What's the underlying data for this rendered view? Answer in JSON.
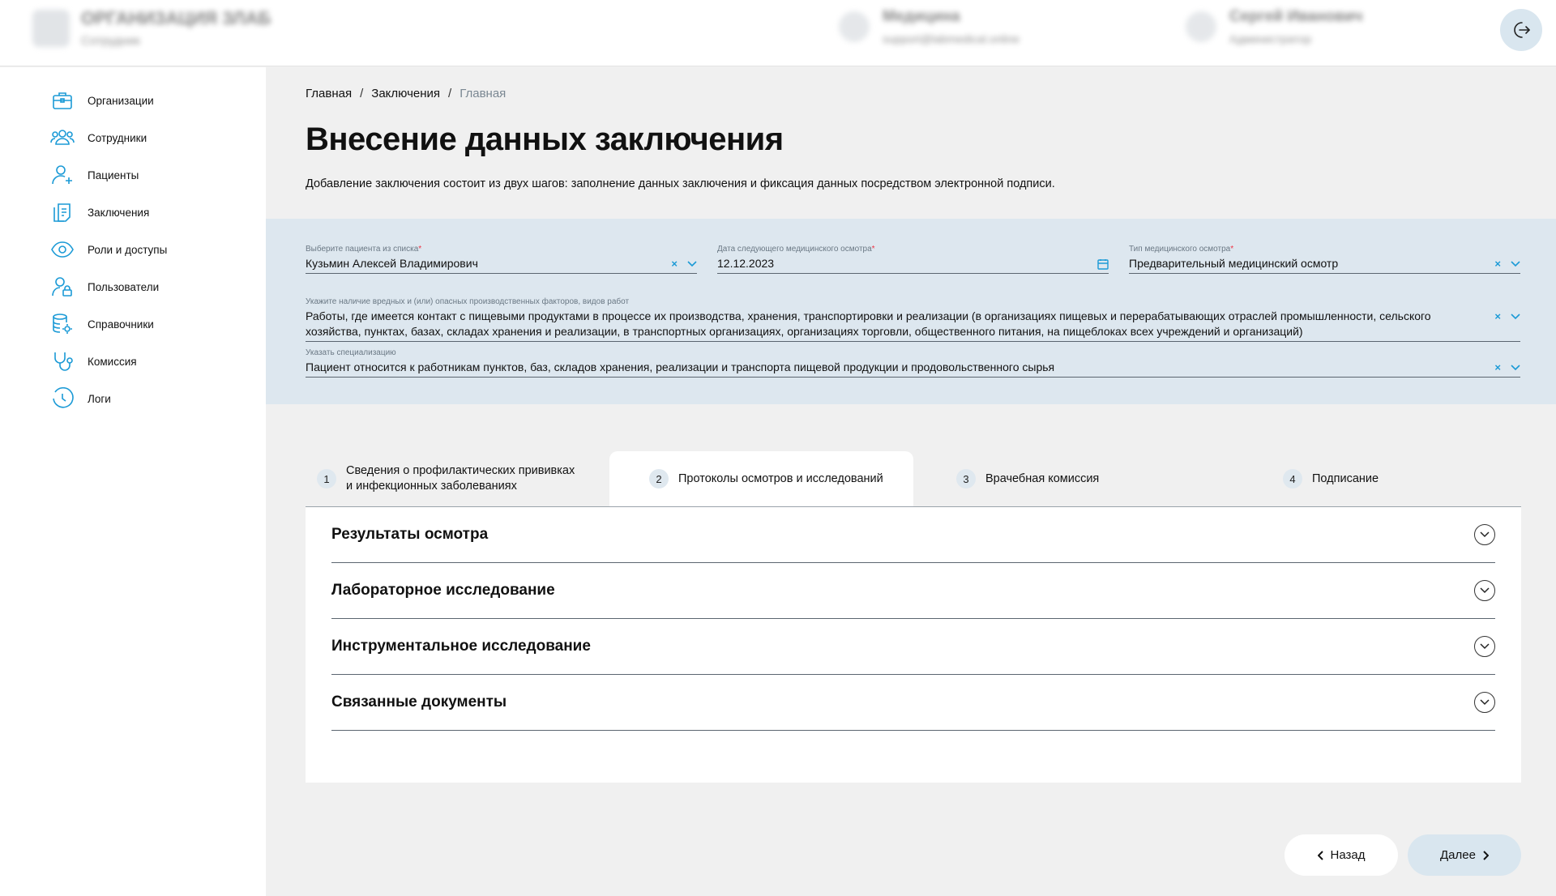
{
  "header": {
    "org_name": "ОРГАНИЗАЦИЯ ЗЛАБ",
    "org_sub": "Сотрудник",
    "block1_title": "Медицина",
    "block1_sub": "support@labmedical.online",
    "block2_title": "Сергей Иванович",
    "block2_sub": "Администратор"
  },
  "sidebar": {
    "items": [
      {
        "label": "Организации",
        "icon": "briefcase-icon"
      },
      {
        "label": "Сотрудники",
        "icon": "users-icon"
      },
      {
        "label": "Пациенты",
        "icon": "user-plus-icon"
      },
      {
        "label": "Заключения",
        "icon": "documents-icon"
      },
      {
        "label": "Роли и доступы",
        "icon": "eye-icon"
      },
      {
        "label": "Пользователи",
        "icon": "user-lock-icon"
      },
      {
        "label": "Справочники",
        "icon": "database-gear-icon"
      },
      {
        "label": "Комиссия",
        "icon": "stethoscope-icon"
      },
      {
        "label": "Логи",
        "icon": "clock-icon"
      }
    ]
  },
  "breadcrumb": [
    "Главная",
    "Заключения",
    "Главная"
  ],
  "page": {
    "title": "Внесение данных заключения",
    "description": "Добавление заключения состоит из двух шагов: заполнение данных заключения и фиксация данных посредством электронной подписи."
  },
  "form": {
    "patient": {
      "label": "Выберите пациента из списка",
      "value": "Кузьмин Алексей Владимирович"
    },
    "next_exam_date": {
      "label": "Дата следующего медицинского осмотра",
      "value": "12.12.2023"
    },
    "exam_type": {
      "label": "Тип медицинского осмотра",
      "value": "Предварительный медицинский осмотр"
    },
    "factors": {
      "label": "Укажите наличие вредных и (или) опасных производственных факторов, видов работ",
      "value": "Работы, где имеется контакт с пищевыми продуктами в процессе их производства, хранения, транспортировки и реализации (в организациях пищевых и перерабатывающих отраслей промышленности, сельского хозяйства, пунктах, базах, складах хранения и реализации, в транспортных организациях, организациях торговли, общественного питания, на пищеблоках всех учреждений и организаций)"
    },
    "specialization": {
      "label": "Указать специализацию",
      "value": "Пациент относится к работникам пунктов, баз, складов хранения, реализации и транспорта пищевой продукции и продовольственного сырья"
    },
    "required_mark": "*"
  },
  "tabs": [
    {
      "num": "1",
      "label_line1": "Сведения о профилактических прививках",
      "label_line2": "и инфекционных заболеваниях"
    },
    {
      "num": "2",
      "label_line1": "Протоколы осмотров и исследований",
      "label_line2": ""
    },
    {
      "num": "3",
      "label_line1": "Врачебная комиссия",
      "label_line2": ""
    },
    {
      "num": "4",
      "label_line1": "Подписание",
      "label_line2": ""
    }
  ],
  "accordions": [
    "Результаты осмотра",
    "Лабораторное исследование",
    "Инструментальное исследование",
    "Связанные документы"
  ],
  "buttons": {
    "back": "Назад",
    "next": "Далее"
  },
  "colors": {
    "accent": "#1b9ad6",
    "band": "#dde7ef",
    "button_blue": "#d9e6ef"
  }
}
